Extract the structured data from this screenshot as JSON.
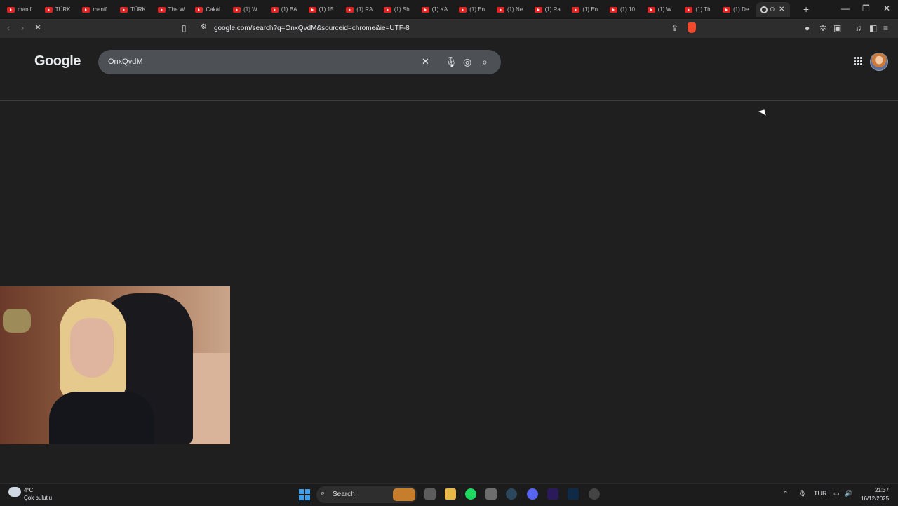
{
  "tabs": [
    {
      "label": "manif"
    },
    {
      "label": "TÜRK"
    },
    {
      "label": "manif"
    },
    {
      "label": "TÜRK"
    },
    {
      "label": "The W"
    },
    {
      "label": "Cakal"
    },
    {
      "label": "(1) W"
    },
    {
      "label": "(1) BA"
    },
    {
      "label": "(1) 15"
    },
    {
      "label": "(1) RA"
    },
    {
      "label": "(1) Sh"
    },
    {
      "label": "(1) KA"
    },
    {
      "label": "(1) En"
    },
    {
      "label": "(1) Ne"
    },
    {
      "label": "(1) Ra"
    },
    {
      "label": "(1) En"
    },
    {
      "label": "(1) 10"
    },
    {
      "label": "(1) W"
    },
    {
      "label": "(1) Th"
    },
    {
      "label": "(1) De"
    }
  ],
  "active_tab": {
    "label": "O"
  },
  "toolbar": {
    "url": "google.com/search?q=OnxQvdM&sourceid=chrome&ie=UTF-8"
  },
  "google": {
    "logo": "Google",
    "query": "OnxQvdM"
  },
  "taskbar": {
    "weather_temp": "4°C",
    "weather_condition": "Çok bulutlu",
    "search_label": "Search",
    "language": "TUR",
    "time": "21:37",
    "date": "16/12/2025"
  },
  "colors": {
    "page_bg": "#1f1f1f",
    "searchbox_bg": "#4d5156",
    "youtube_red": "#e02424",
    "windows_blue": "#3a9ff0"
  }
}
